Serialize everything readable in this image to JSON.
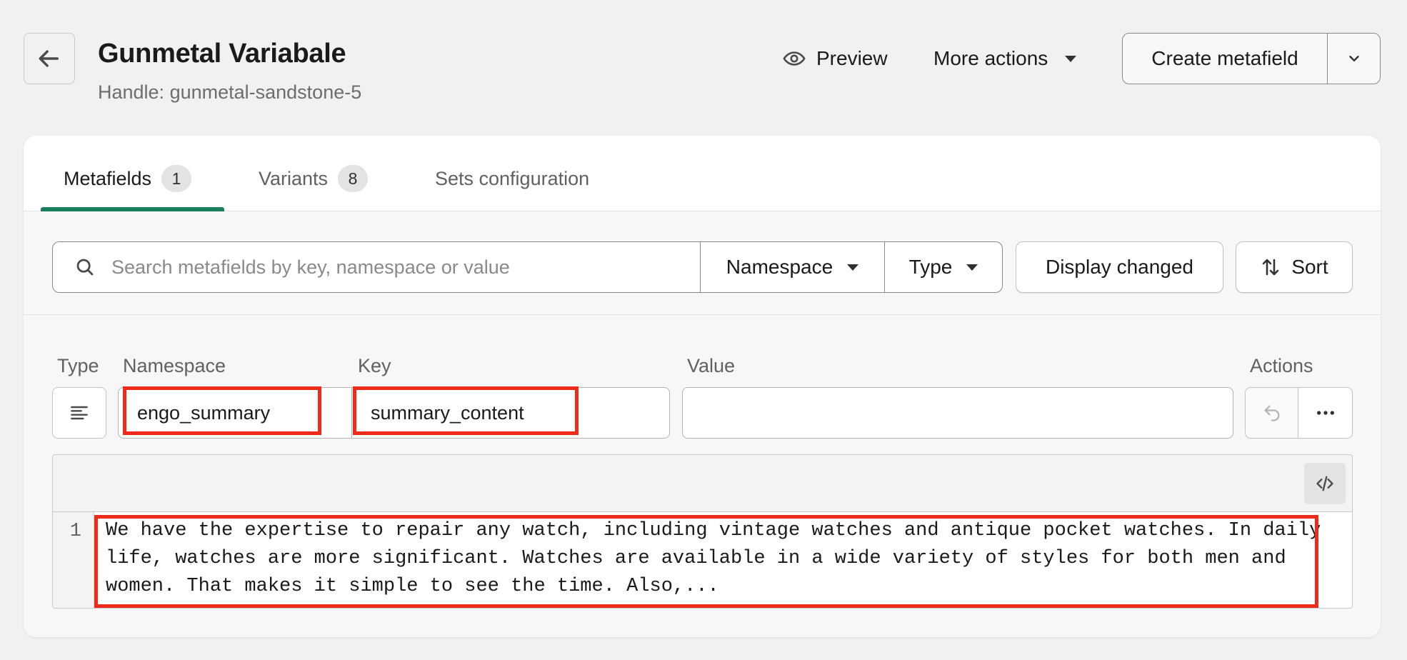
{
  "header": {
    "title": "Gunmetal Variabale",
    "handle": "Handle: gunmetal-sandstone-5",
    "preview_label": "Preview",
    "more_actions_label": "More actions",
    "create_label": "Create metafield"
  },
  "tabs": [
    {
      "label": "Metafields",
      "count": "1",
      "active": true
    },
    {
      "label": "Variants",
      "count": "8",
      "active": false
    },
    {
      "label": "Sets configuration",
      "active": false
    }
  ],
  "filters": {
    "search_placeholder": "Search metafields by key, namespace or value",
    "namespace_label": "Namespace",
    "type_label": "Type",
    "display_changed_label": "Display changed",
    "sort_label": "Sort"
  },
  "columns": {
    "type": "Type",
    "namespace": "Namespace",
    "key": "Key",
    "value": "Value",
    "actions": "Actions"
  },
  "metafield": {
    "namespace": "engo_summary",
    "key": "summary_content",
    "value": "",
    "line_number": "1",
    "content": "We have the expertise to repair any watch, including vintage watches and antique pocket watches. In daily life, watches are more significant. Watches are available in a wide variety of styles for both men and women. That makes it simple to see the time. Also,..."
  },
  "colors": {
    "accent_tab": "#1a7f5a",
    "highlight": "#ee2a1b"
  },
  "icons": {
    "back": "arrow-left-icon",
    "preview": "eye-icon",
    "type": "text-lines-icon",
    "search": "search-icon",
    "sort": "sort-arrows-icon",
    "undo": "undo-icon",
    "more": "ellipsis-icon",
    "code": "code-icon"
  }
}
